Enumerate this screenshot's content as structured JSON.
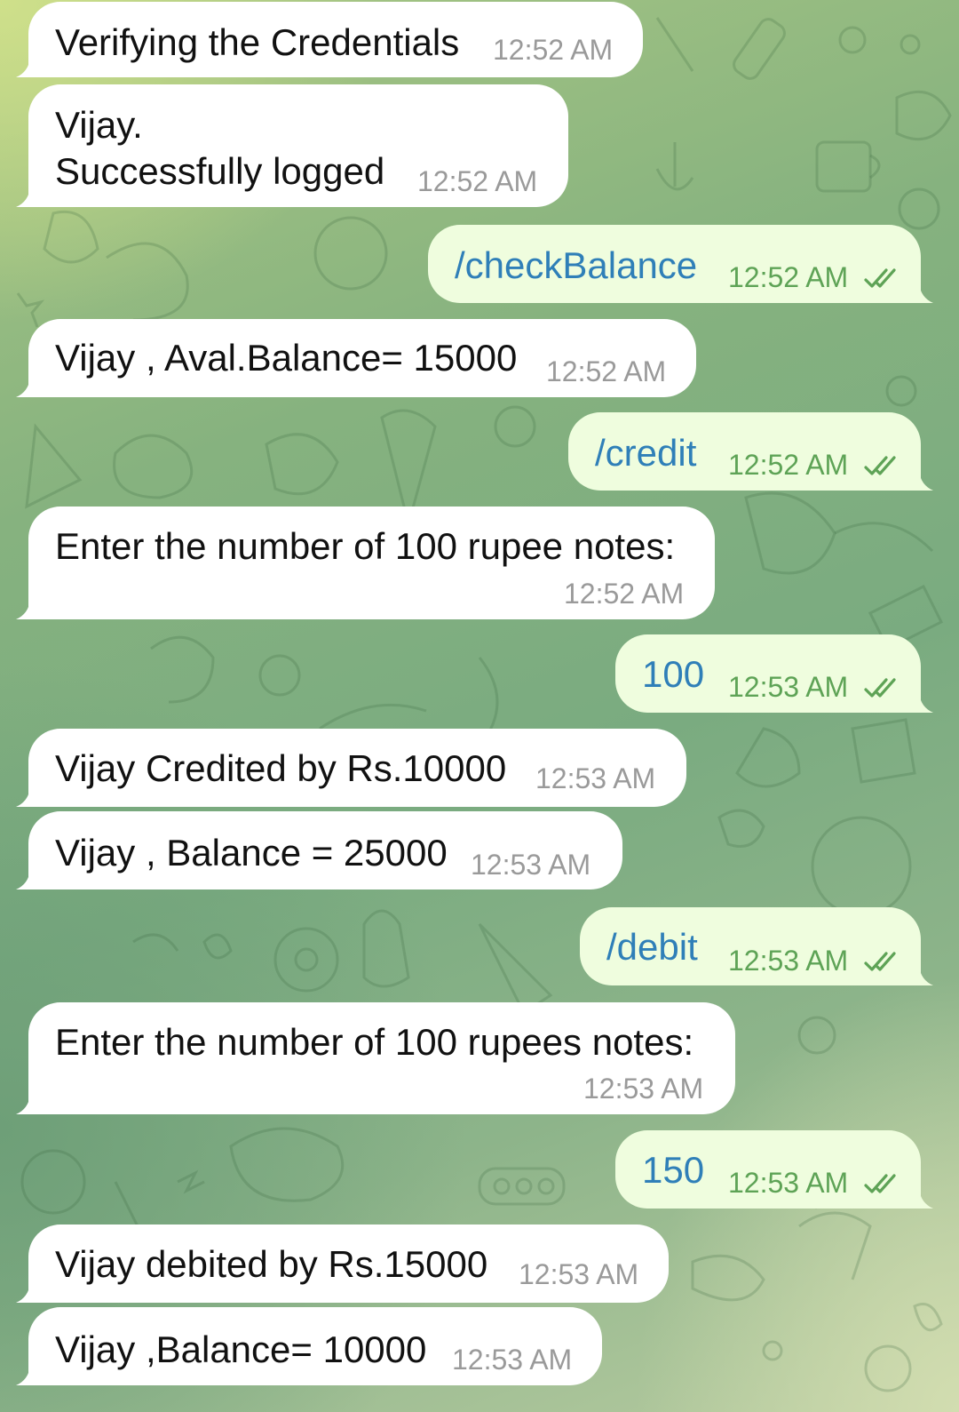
{
  "messages": [
    {
      "dir": "in",
      "text": "Verifying the Credentials",
      "time": "12:52 AM"
    },
    {
      "dir": "in",
      "line1": "Vijay.",
      "line2": "Successfully logged",
      "time": "12:52 AM"
    },
    {
      "dir": "out",
      "text": "/checkBalance",
      "time": "12:52 AM",
      "status": "double-check-icon"
    },
    {
      "dir": "in",
      "text": "Vijay , Aval.Balance= 15000",
      "time": "12:52 AM"
    },
    {
      "dir": "out",
      "text": "/credit",
      "time": "12:52 AM",
      "status": "double-check-icon"
    },
    {
      "dir": "in",
      "text": "Enter the number of 100 rupee notes:",
      "time": "12:52 AM"
    },
    {
      "dir": "out",
      "text": "100",
      "time": "12:53 AM",
      "status": "double-check-icon"
    },
    {
      "dir": "in",
      "text": "Vijay Credited by Rs.10000",
      "time": "12:53 AM"
    },
    {
      "dir": "in",
      "text": "Vijay , Balance = 25000",
      "time": "12:53 AM"
    },
    {
      "dir": "out",
      "text": "/debit",
      "time": "12:53 AM",
      "status": "double-check-icon"
    },
    {
      "dir": "in",
      "text": "Enter the number of 100 rupees notes:",
      "time": "12:53 AM"
    },
    {
      "dir": "out",
      "text": "150",
      "time": "12:53 AM",
      "status": "double-check-icon"
    },
    {
      "dir": "in",
      "text": "Vijay debited by Rs.15000",
      "time": "12:53 AM"
    },
    {
      "dir": "in",
      "text": "Vijay ,Balance= 10000",
      "time": "12:53 AM"
    }
  ],
  "colors": {
    "incoming_bubble": "#ffffff",
    "outgoing_bubble": "#effdde",
    "outgoing_text": "#2f7fb8",
    "outgoing_time": "#5ea356",
    "incoming_time": "#9a9a9a"
  }
}
